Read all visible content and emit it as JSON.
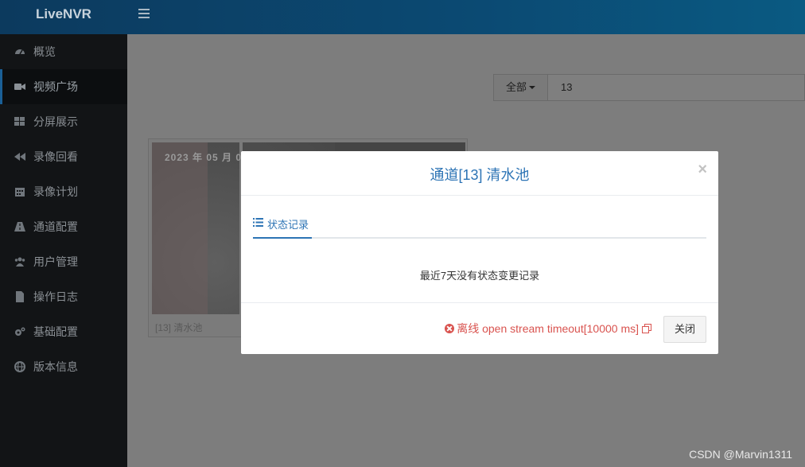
{
  "app": {
    "title": "LiveNVR"
  },
  "sidebar": {
    "items": [
      {
        "label": "概览",
        "icon": "dashboard-icon",
        "active": false
      },
      {
        "label": "视频广场",
        "icon": "video-camera-icon",
        "active": true
      },
      {
        "label": "分屏展示",
        "icon": "grid-icon",
        "active": false
      },
      {
        "label": "录像回看",
        "icon": "backward-icon",
        "active": false
      },
      {
        "label": "录像计划",
        "icon": "calendar-icon",
        "active": false
      },
      {
        "label": "通道配置",
        "icon": "road-icon",
        "active": false
      },
      {
        "label": "用户管理",
        "icon": "users-icon",
        "active": false
      },
      {
        "label": "操作日志",
        "icon": "file-icon",
        "active": false
      },
      {
        "label": "基础配置",
        "icon": "gears-icon",
        "active": false
      },
      {
        "label": "版本信息",
        "icon": "globe-icon",
        "active": false
      }
    ]
  },
  "search": {
    "filter_label": "全部",
    "value": "13"
  },
  "card": {
    "label": "[13] 清水池",
    "osd_text": "2023 年 05 月 0"
  },
  "modal": {
    "title": "通道[13] 清水池",
    "close_symbol": "×",
    "tab_label": "状态记录",
    "empty_message": "最近7天没有状态变更记录",
    "status_text": "离线 open stream timeout[10000 ms]",
    "close_button": "关闭"
  },
  "watermark": "CSDN @Marvin1311",
  "colors": {
    "accent": "#2d74b5",
    "error": "#d9534f",
    "sidebar_bg": "#121416",
    "header_bg": "#0b4a73"
  }
}
